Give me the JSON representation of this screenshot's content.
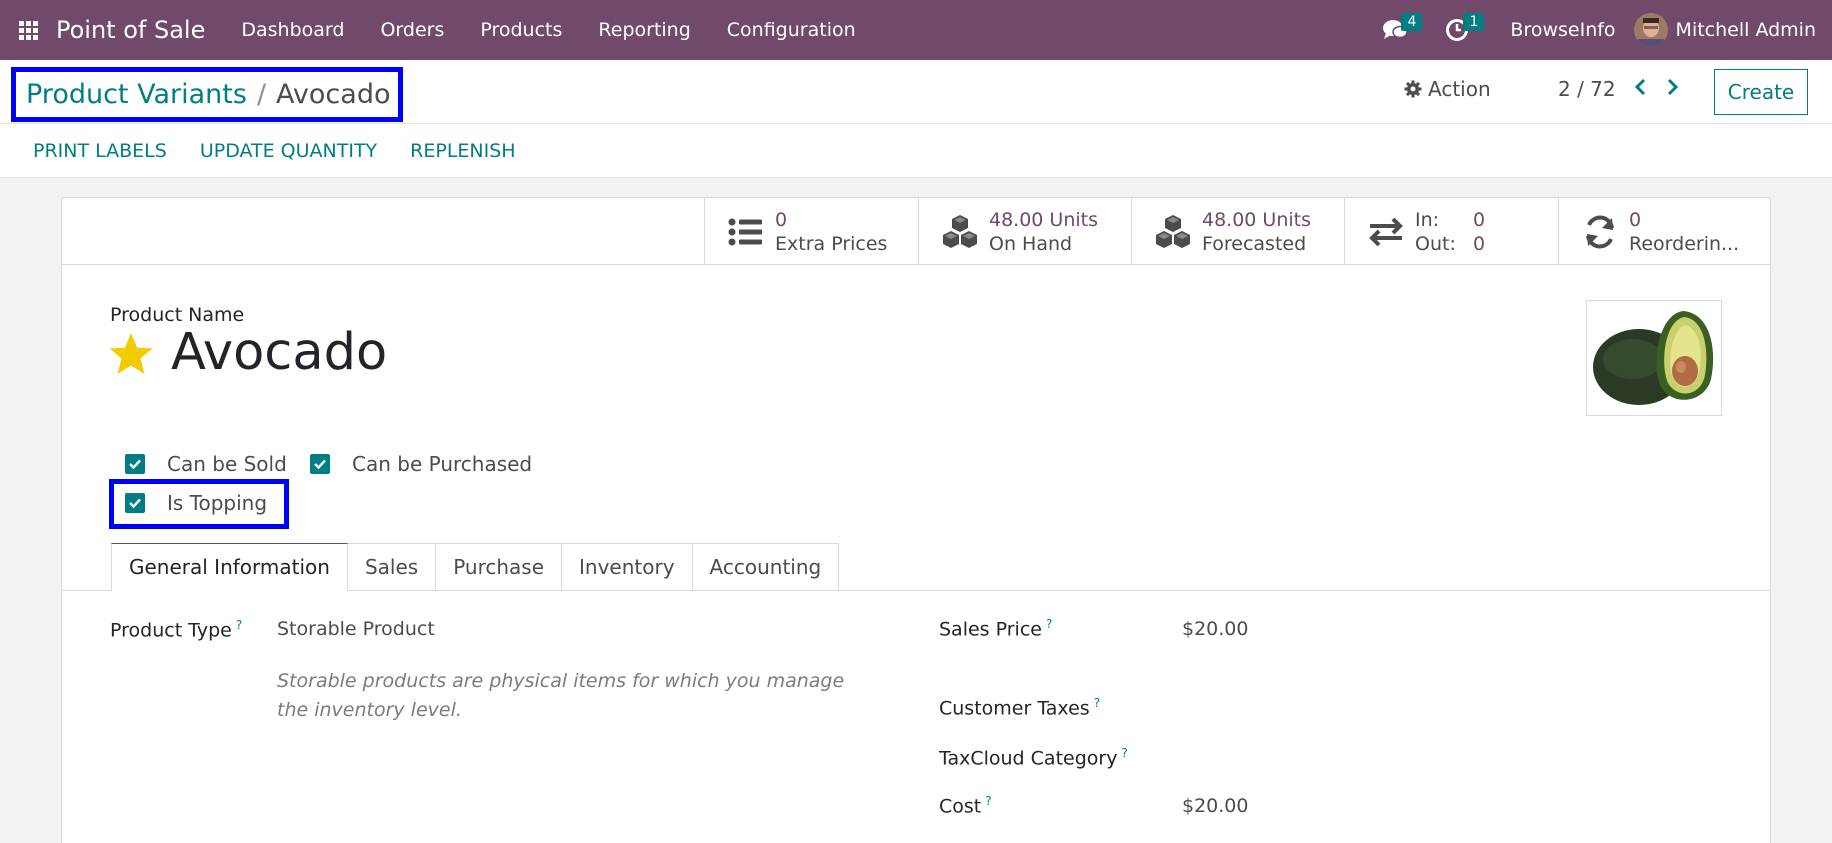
{
  "nav": {
    "app_title": "Point of Sale",
    "menu": [
      "Dashboard",
      "Orders",
      "Products",
      "Reporting",
      "Configuration"
    ],
    "messages_count": "4",
    "activities_count": "1",
    "company": "BrowseInfo",
    "user": "Mitchell Admin"
  },
  "control": {
    "breadcrumb_parent": "Product Variants",
    "breadcrumb_sep": "/",
    "breadcrumb_current": "Avocado",
    "action_label": "Action",
    "pager": "2 / 72",
    "create_label": "Create",
    "status_buttons": [
      "PRINT LABELS",
      "UPDATE QUANTITY",
      "REPLENISH"
    ]
  },
  "stats": {
    "extra_prices_value": "0",
    "extra_prices_label": "Extra Prices",
    "on_hand_value": "48.00 Units",
    "on_hand_label": "On Hand",
    "forecasted_value": "48.00 Units",
    "forecasted_label": "Forecasted",
    "in_label": "In:",
    "in_value": "0",
    "out_label": "Out:",
    "out_value": "0",
    "reordering_value": "0",
    "reordering_label": "Reorderin..."
  },
  "product": {
    "name_label": "Product Name",
    "name": "Avocado",
    "can_be_sold": "Can be Sold",
    "can_be_purchased": "Can be Purchased",
    "is_topping": "Is Topping"
  },
  "tabs": [
    "General Information",
    "Sales",
    "Purchase",
    "Inventory",
    "Accounting"
  ],
  "general": {
    "product_type_label": "Product Type",
    "product_type_value": "Storable Product",
    "product_type_help": "Storable products are physical items for which you manage the inventory level.",
    "sales_price_label": "Sales Price",
    "sales_price_value": "$20.00",
    "customer_taxes_label": "Customer Taxes",
    "taxcloud_label": "TaxCloud Category",
    "cost_label": "Cost",
    "cost_value": "$20.00",
    "help_marker": "?"
  },
  "colors": {
    "nav_bg": "#71496a",
    "accent": "#017e84",
    "highlight_box": "#0000ff",
    "star": "#f3cc00"
  }
}
